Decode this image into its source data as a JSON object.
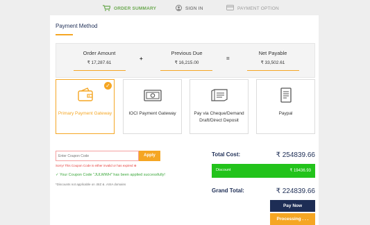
{
  "steps": [
    {
      "label": "ORDER SUMMARY",
      "icon": "cart-icon"
    },
    {
      "label": "SIGN IN",
      "icon": "user-icon"
    },
    {
      "label": "PAYMENT OPTION",
      "icon": "card-icon"
    }
  ],
  "section_title": "Payment Method",
  "summary": {
    "order_amount_label": "Order Amount",
    "order_amount_value": "₹ 17,287.61",
    "plus": "+",
    "previous_due_label": "Previous Due",
    "previous_due_value": "₹ 16,215.00",
    "equals": "=",
    "net_payable_label": "Net Payable",
    "net_payable_value": "₹ 33,502.61"
  },
  "methods": [
    {
      "label": "Primary Payment Gateway",
      "icon": "wallet-icon",
      "selected": true
    },
    {
      "label": "IOCI Payment Gateway",
      "icon": "cash-icon",
      "selected": false
    },
    {
      "label": "Pay via Cheque/Demand Draft/Direct Deposit",
      "icon": "cheque-icon",
      "selected": false
    },
    {
      "label": "Paypal",
      "icon": "receipt-icon",
      "selected": false
    }
  ],
  "coupon": {
    "placeholder": "Enter Coupon Code",
    "apply_label": "Apply",
    "error": "Sorry! This Coupon Code is either invalid or has expired ⊗",
    "success": "✓ Your Coupon Code \"JULWWH\" has been applied successfully!",
    "note": "*Discounts not applicable on .BIZ & .ASIA domains"
  },
  "totals": {
    "total_cost_label": "Total Cost:",
    "total_cost_value": "₹ 254839.66",
    "discount_label": "Discount",
    "discount_value": "₹ 19436.93",
    "grand_total_label": "Grand Total:",
    "grand_total_value": "₹ 224839.66"
  },
  "actions": {
    "pay_now": "Pay Now",
    "processing": "Processing . . ."
  },
  "colors": {
    "accent": "#f5a623",
    "navy": "#1d2d55",
    "success_green": "#22c31b",
    "active_step_green": "#6aa84f"
  }
}
